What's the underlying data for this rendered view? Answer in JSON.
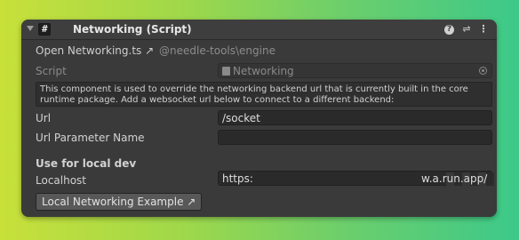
{
  "component": {
    "title": "Networking (Script)",
    "checkbox_glyph": "#",
    "icons": [
      "help-icon",
      "presets-icon",
      "menu-icon"
    ]
  },
  "links": {
    "open_script": "Open Networking.ts ↗",
    "package": "@needle-tools\\engine"
  },
  "script": {
    "label": "Script",
    "value": "Networking"
  },
  "helpbox": {
    "text": "This component is used to override the networking backend url that is currently built in the core runtime package. Add a websocket url below to connect to a different backend:"
  },
  "fields": {
    "url_label": "Url",
    "url_value": "/socket",
    "url_param_label": "Url Parameter Name",
    "url_param_value": ""
  },
  "local_dev": {
    "header": "Use for local dev",
    "localhost_label": "Localhost",
    "localhost_prefix": "https:",
    "localhost_suffix": "w.a.run.app/"
  },
  "button": {
    "label": "Local Networking Example ↗"
  }
}
